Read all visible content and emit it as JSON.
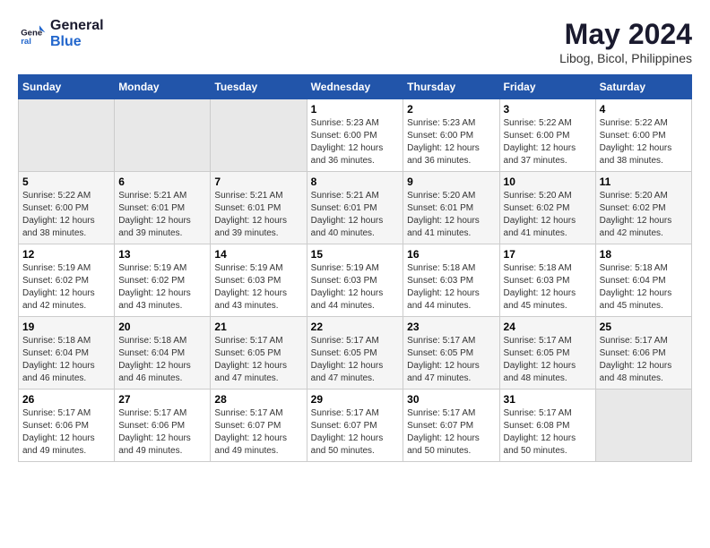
{
  "logo": {
    "line1": "General",
    "line2": "Blue"
  },
  "title": "May 2024",
  "subtitle": "Libog, Bicol, Philippines",
  "days_of_week": [
    "Sunday",
    "Monday",
    "Tuesday",
    "Wednesday",
    "Thursday",
    "Friday",
    "Saturday"
  ],
  "weeks": [
    [
      {
        "day": "",
        "info": ""
      },
      {
        "day": "",
        "info": ""
      },
      {
        "day": "",
        "info": ""
      },
      {
        "day": "1",
        "info": "Sunrise: 5:23 AM\nSunset: 6:00 PM\nDaylight: 12 hours and 36 minutes."
      },
      {
        "day": "2",
        "info": "Sunrise: 5:23 AM\nSunset: 6:00 PM\nDaylight: 12 hours and 36 minutes."
      },
      {
        "day": "3",
        "info": "Sunrise: 5:22 AM\nSunset: 6:00 PM\nDaylight: 12 hours and 37 minutes."
      },
      {
        "day": "4",
        "info": "Sunrise: 5:22 AM\nSunset: 6:00 PM\nDaylight: 12 hours and 38 minutes."
      }
    ],
    [
      {
        "day": "5",
        "info": "Sunrise: 5:22 AM\nSunset: 6:00 PM\nDaylight: 12 hours and 38 minutes."
      },
      {
        "day": "6",
        "info": "Sunrise: 5:21 AM\nSunset: 6:01 PM\nDaylight: 12 hours and 39 minutes."
      },
      {
        "day": "7",
        "info": "Sunrise: 5:21 AM\nSunset: 6:01 PM\nDaylight: 12 hours and 39 minutes."
      },
      {
        "day": "8",
        "info": "Sunrise: 5:21 AM\nSunset: 6:01 PM\nDaylight: 12 hours and 40 minutes."
      },
      {
        "day": "9",
        "info": "Sunrise: 5:20 AM\nSunset: 6:01 PM\nDaylight: 12 hours and 41 minutes."
      },
      {
        "day": "10",
        "info": "Sunrise: 5:20 AM\nSunset: 6:02 PM\nDaylight: 12 hours and 41 minutes."
      },
      {
        "day": "11",
        "info": "Sunrise: 5:20 AM\nSunset: 6:02 PM\nDaylight: 12 hours and 42 minutes."
      }
    ],
    [
      {
        "day": "12",
        "info": "Sunrise: 5:19 AM\nSunset: 6:02 PM\nDaylight: 12 hours and 42 minutes."
      },
      {
        "day": "13",
        "info": "Sunrise: 5:19 AM\nSunset: 6:02 PM\nDaylight: 12 hours and 43 minutes."
      },
      {
        "day": "14",
        "info": "Sunrise: 5:19 AM\nSunset: 6:03 PM\nDaylight: 12 hours and 43 minutes."
      },
      {
        "day": "15",
        "info": "Sunrise: 5:19 AM\nSunset: 6:03 PM\nDaylight: 12 hours and 44 minutes."
      },
      {
        "day": "16",
        "info": "Sunrise: 5:18 AM\nSunset: 6:03 PM\nDaylight: 12 hours and 44 minutes."
      },
      {
        "day": "17",
        "info": "Sunrise: 5:18 AM\nSunset: 6:03 PM\nDaylight: 12 hours and 45 minutes."
      },
      {
        "day": "18",
        "info": "Sunrise: 5:18 AM\nSunset: 6:04 PM\nDaylight: 12 hours and 45 minutes."
      }
    ],
    [
      {
        "day": "19",
        "info": "Sunrise: 5:18 AM\nSunset: 6:04 PM\nDaylight: 12 hours and 46 minutes."
      },
      {
        "day": "20",
        "info": "Sunrise: 5:18 AM\nSunset: 6:04 PM\nDaylight: 12 hours and 46 minutes."
      },
      {
        "day": "21",
        "info": "Sunrise: 5:17 AM\nSunset: 6:05 PM\nDaylight: 12 hours and 47 minutes."
      },
      {
        "day": "22",
        "info": "Sunrise: 5:17 AM\nSunset: 6:05 PM\nDaylight: 12 hours and 47 minutes."
      },
      {
        "day": "23",
        "info": "Sunrise: 5:17 AM\nSunset: 6:05 PM\nDaylight: 12 hours and 47 minutes."
      },
      {
        "day": "24",
        "info": "Sunrise: 5:17 AM\nSunset: 6:05 PM\nDaylight: 12 hours and 48 minutes."
      },
      {
        "day": "25",
        "info": "Sunrise: 5:17 AM\nSunset: 6:06 PM\nDaylight: 12 hours and 48 minutes."
      }
    ],
    [
      {
        "day": "26",
        "info": "Sunrise: 5:17 AM\nSunset: 6:06 PM\nDaylight: 12 hours and 49 minutes."
      },
      {
        "day": "27",
        "info": "Sunrise: 5:17 AM\nSunset: 6:06 PM\nDaylight: 12 hours and 49 minutes."
      },
      {
        "day": "28",
        "info": "Sunrise: 5:17 AM\nSunset: 6:07 PM\nDaylight: 12 hours and 49 minutes."
      },
      {
        "day": "29",
        "info": "Sunrise: 5:17 AM\nSunset: 6:07 PM\nDaylight: 12 hours and 50 minutes."
      },
      {
        "day": "30",
        "info": "Sunrise: 5:17 AM\nSunset: 6:07 PM\nDaylight: 12 hours and 50 minutes."
      },
      {
        "day": "31",
        "info": "Sunrise: 5:17 AM\nSunset: 6:08 PM\nDaylight: 12 hours and 50 minutes."
      },
      {
        "day": "",
        "info": ""
      }
    ]
  ]
}
